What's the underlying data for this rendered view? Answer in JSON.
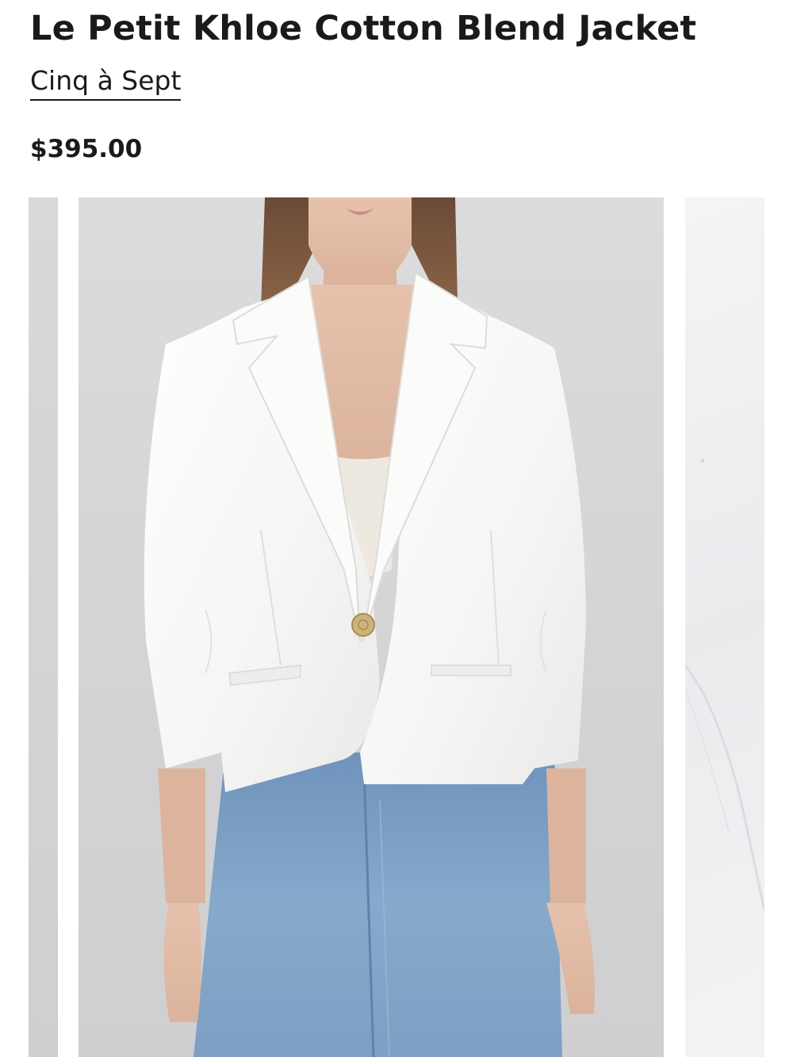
{
  "product": {
    "title": "Le Petit Khloe Cotton Blend Jacket",
    "brand": "Cinq à Sept",
    "price": "$395.00"
  },
  "gallery": {
    "main_image_alt": "Model wearing white cotton blend blazer with gold button and blue jeans",
    "next_image_alt": "Close-up of white jacket fabric"
  },
  "colors": {
    "text": "#191a1b",
    "background": "#ffffff",
    "photo_background": "#d6d6d8",
    "jacket": "#f7f7f5",
    "denim": "#7fa3c8",
    "button_gold": "#cdb27a"
  }
}
